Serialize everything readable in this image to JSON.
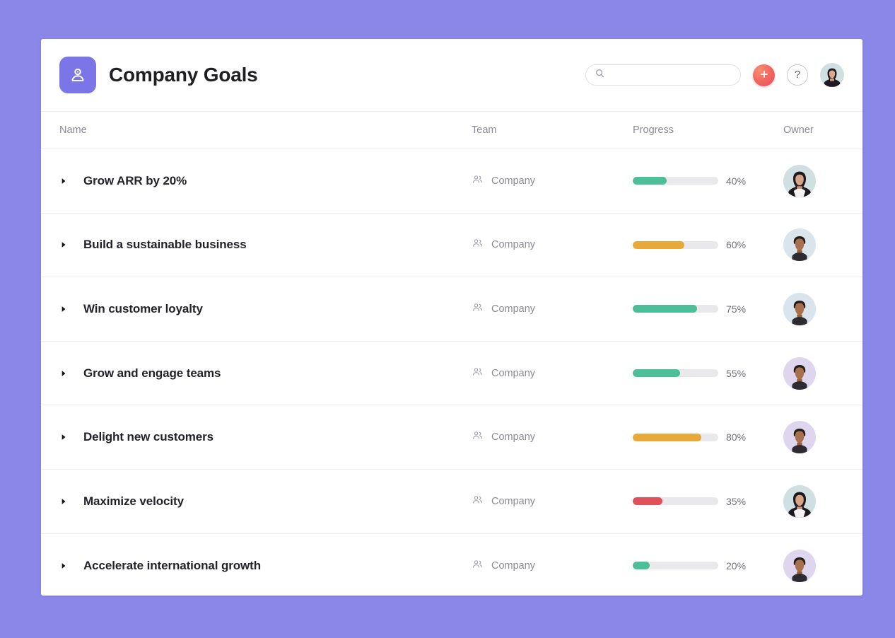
{
  "theme": {
    "page_background": "#8b87e8",
    "brand_purple": "#7b75e8",
    "green": "#4cbf99",
    "orange": "#e8a93a",
    "red": "#e0515a",
    "track_gray": "#e9e9ec"
  },
  "header": {
    "title": "Company Goals",
    "brand_icon": "goal-person-icon",
    "search": {
      "icon": "search-icon",
      "value": "",
      "placeholder": ""
    },
    "add_button": {
      "icon": "plus-icon",
      "label": "+"
    },
    "help_button": {
      "icon": "question-mark-icon",
      "label": "?"
    },
    "user_avatar": {
      "icon": "avatar",
      "background": "#cfdfe2",
      "type": "female"
    }
  },
  "table": {
    "columns": [
      {
        "key": "name",
        "label": "Name"
      },
      {
        "key": "team",
        "label": "Team"
      },
      {
        "key": "progress",
        "label": "Progress"
      },
      {
        "key": "owner",
        "label": "Owner"
      }
    ],
    "rows": [
      {
        "disclosure_icon": "triangle-right-icon",
        "name": "Grow ARR by 20%",
        "team_icon": "people-icon",
        "team": "Company",
        "progress": 40,
        "progress_label": "40%",
        "progress_color": "#4cbf99",
        "owner": {
          "background": "#cfdfe2",
          "type": "female"
        }
      },
      {
        "disclosure_icon": "triangle-right-icon",
        "name": "Build a sustainable business",
        "team_icon": "people-icon",
        "team": "Company",
        "progress": 60,
        "progress_label": "60%",
        "progress_color": "#e8a93a",
        "owner": {
          "background": "#d9e4ec",
          "type": "male"
        }
      },
      {
        "disclosure_icon": "triangle-right-icon",
        "name": "Win customer loyalty",
        "team_icon": "people-icon",
        "team": "Company",
        "progress": 75,
        "progress_label": "75%",
        "progress_color": "#4cbf99",
        "owner": {
          "background": "#d9e4ec",
          "type": "male"
        }
      },
      {
        "disclosure_icon": "triangle-right-icon",
        "name": "Grow and engage teams",
        "team_icon": "people-icon",
        "team": "Company",
        "progress": 55,
        "progress_label": "55%",
        "progress_color": "#4cbf99",
        "owner": {
          "background": "#ded6ef",
          "type": "male"
        }
      },
      {
        "disclosure_icon": "triangle-right-icon",
        "name": "Delight new customers",
        "team_icon": "people-icon",
        "team": "Company",
        "progress": 80,
        "progress_label": "80%",
        "progress_color": "#e8a93a",
        "owner": {
          "background": "#ded6ef",
          "type": "male"
        }
      },
      {
        "disclosure_icon": "triangle-right-icon",
        "name": "Maximize velocity",
        "team_icon": "people-icon",
        "team": "Company",
        "progress": 35,
        "progress_label": "35%",
        "progress_color": "#e0515a",
        "owner": {
          "background": "#cfdfe2",
          "type": "female"
        }
      },
      {
        "disclosure_icon": "triangle-right-icon",
        "name": "Accelerate international growth",
        "team_icon": "people-icon",
        "team": "Company",
        "progress": 20,
        "progress_label": "20%",
        "progress_color": "#4cbf99",
        "owner": {
          "background": "#ded6ef",
          "type": "male"
        }
      }
    ]
  }
}
